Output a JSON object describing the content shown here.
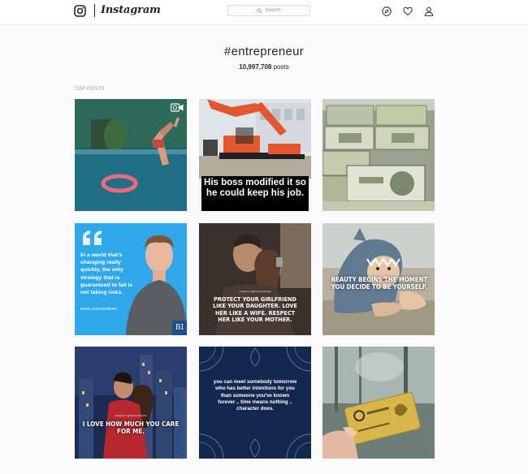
{
  "header": {
    "brand": "Instagram",
    "search_placeholder": "Search"
  },
  "hashtag": {
    "title": "#entrepreneur",
    "post_count": "10,997,708",
    "post_count_suffix": "posts"
  },
  "section": {
    "label": "TOP POSTS"
  },
  "posts": [
    {
      "watermark": ""
    },
    {
      "caption": "His boss modified it so he could keep his job."
    },
    {
      "caption": ""
    },
    {
      "quote": "In a world that's changing really quickly, the only strategy that is guaranteed to fail is not taking risks.",
      "author": "MARK ZUCKERBERG",
      "badge": "BI"
    },
    {
      "brand": "Instagram: @Success.Empire",
      "caption": "PROTECT YOUR GIRLFRIEND LIKE YOUR DAUGHTER. LOVE HER LIKE A WIFE. RESPECT HER LIKE YOUR MOTHER."
    },
    {
      "caption": "BEAUTY BEGINS THE MOMENT YOU DECIDE TO BE YOURSELF."
    },
    {
      "brand": "Instagram: @Success.Empire",
      "caption": "I LOVE HOW MUCH YOU CARE FOR ME."
    },
    {
      "caption": "you can meet somebody tomorrow who has better intentions for you than someone you've known forever .. time means nothing .. character does."
    },
    {
      "caption": ""
    }
  ],
  "colors": {
    "nav_bg": "#ffffff",
    "page_bg": "#fafafa",
    "text": "#262626",
    "muted": "#999999",
    "border": "#dbdbdb"
  }
}
